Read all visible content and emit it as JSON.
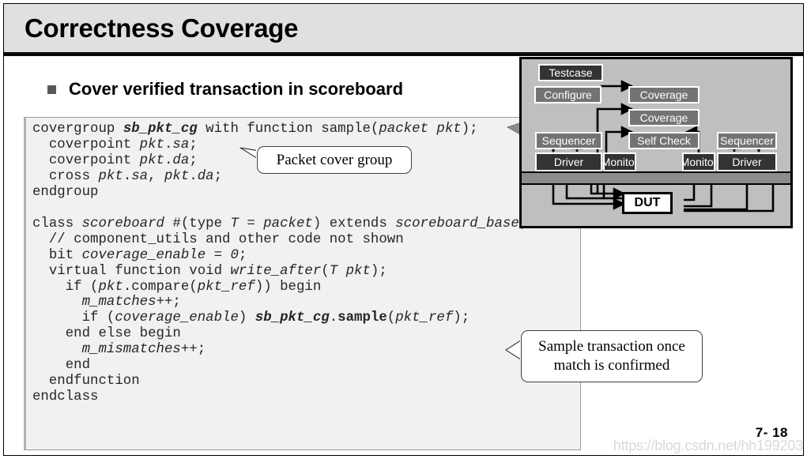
{
  "slide": {
    "title": "Correctness Coverage",
    "bullet": "Cover verified transaction in scoreboard",
    "slide_number": "7- 18",
    "watermark": "https://blog.csdn.net/hh199203"
  },
  "code": {
    "language": "SystemVerilog",
    "lines": [
      "covergroup sb_pkt_cg with function sample(packet pkt);",
      "  coverpoint pkt.sa;",
      "  coverpoint pkt.da;",
      "  cross pkt.sa, pkt.da;",
      "endgroup",
      "",
      "class scoreboard #(type T = packet) extends scoreboard_base;",
      "  // component_utils and other code not shown",
      "  bit coverage_enable = 0;",
      "  virtual function void write_after(T pkt);",
      "    if (pkt.compare(pkt_ref)) begin",
      "      m_matches++;",
      "      if (coverage_enable) sb_pkt_cg.sample(pkt_ref);",
      "    end else begin",
      "      m_mismatches++;",
      "    end",
      "  endfunction",
      "endclass"
    ]
  },
  "callouts": {
    "packet_cover_group": "Packet cover group",
    "sample_transaction_line1": "Sample transaction once",
    "sample_transaction_line2": "match is confirmed"
  },
  "diagram": {
    "title": "testbench-architecture",
    "boxes": {
      "testcase": "Testcase",
      "configure": "Configure",
      "coverage_top": "Coverage",
      "coverage_bottom": "Coverage",
      "self_check": "Self Check",
      "sequencer_left": "Sequencer",
      "sequencer_right": "Sequencer",
      "driver_left": "Driver",
      "driver_right": "Driver",
      "monitor_left": "Monitor",
      "monitor_right": "Monitor",
      "dut": "DUT"
    }
  },
  "colors": {
    "title_bar_bg": "#e0e0e0",
    "code_bg": "#f1f1f1",
    "diagram_bg": "#bfbfbf",
    "box_gray": "#737373",
    "box_dark": "#333333",
    "bullet": "#595959"
  }
}
